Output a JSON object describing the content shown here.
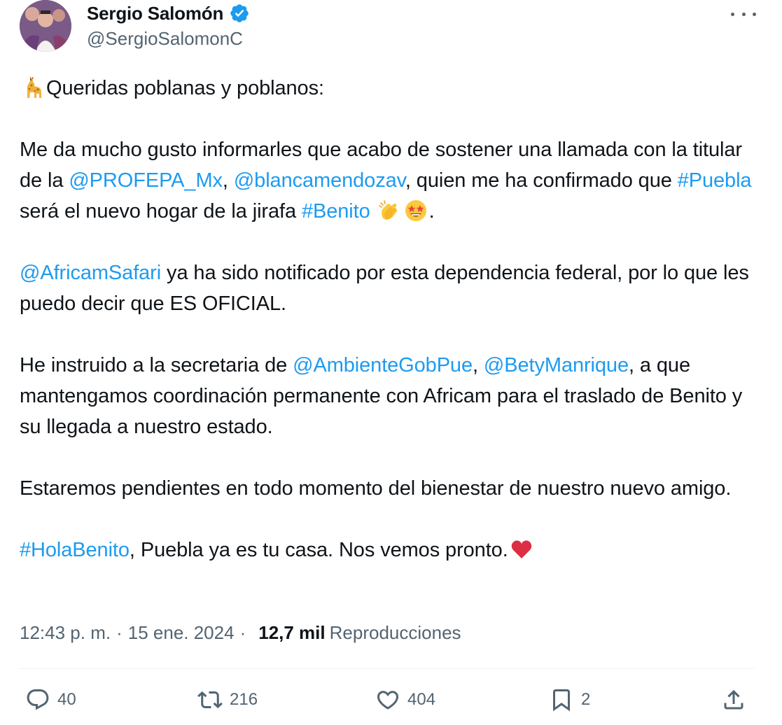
{
  "author": {
    "display_name": "Sergio Salomón",
    "handle": "@SergioSalomonC",
    "verified": true,
    "verified_color": "#1d9bf0"
  },
  "tweet": {
    "p1": {
      "emoji": "giraffe",
      "text": "Queridas poblanas y poblanos:"
    },
    "p2": {
      "t1": "Me da mucho gusto informarles que acabo de sostener una llamada con la titular de la ",
      "m1": "@PROFEPA_Mx",
      "t2": ", ",
      "m2": "@blancamendozav",
      "t3": ", quien me ha confirmado que ",
      "h1": "#Puebla",
      "t4": " será el nuevo hogar de la jirafa ",
      "h2": "#Benito",
      "emojis": [
        "clapping-hands",
        "star-struck"
      ],
      "t5": "."
    },
    "p3": {
      "m1": "@AfricamSafari",
      "t1": " ya ha sido notificado por esta dependencia federal, por lo que les puedo decir que ES OFICIAL."
    },
    "p4": {
      "t1": "He instruido a la secretaria de ",
      "m1": "@AmbienteGobPue",
      "t2": ", ",
      "m2": "@BetyManrique",
      "t3": ", a que mantengamos coordinación permanente con Africam para el traslado de Benito y su llegada a nuestro estado."
    },
    "p5": {
      "t1": "Estaremos pendientes en todo momento del bienestar de nuestro nuevo amigo."
    },
    "p6": {
      "h1": "#HolaBenito",
      "t1": ", Puebla ya es tu casa. Nos vemos pronto.",
      "emoji": "red-heart"
    }
  },
  "meta": {
    "time": "12:43 p. m.",
    "separator": "·",
    "date": "15 ene. 2024",
    "views_count": "12,7 mil",
    "views_label": "Reproducciones"
  },
  "actions": {
    "replies": "40",
    "reposts": "216",
    "likes": "404",
    "bookmarks": "2"
  },
  "colors": {
    "link": "#1d9bf0",
    "text": "#0f1419",
    "secondary": "#536471"
  }
}
